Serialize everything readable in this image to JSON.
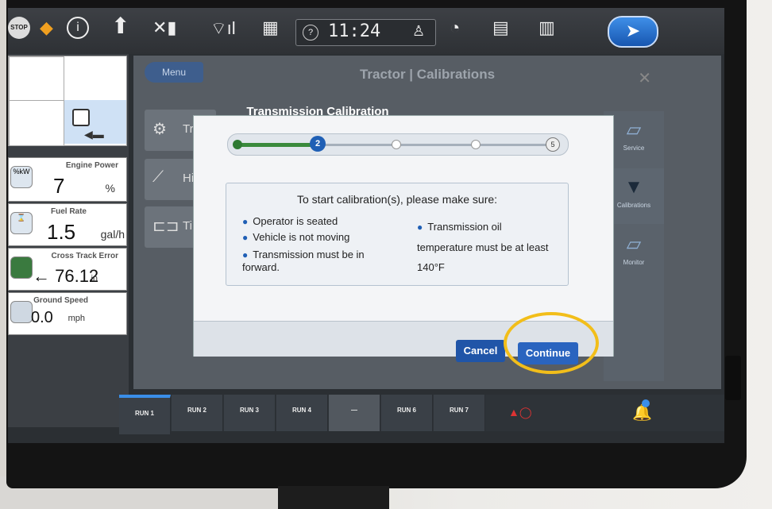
{
  "status_bar": {
    "stop_icon": "STOP",
    "time": "11:24",
    "home_icon": "home-arrow-icon"
  },
  "left_panel": {
    "gauges": [
      {
        "label": "Engine Power",
        "value": "7",
        "unit": "%",
        "icon": "%kW"
      },
      {
        "label": "Fuel Rate",
        "value": "1.5",
        "unit": "gal/h",
        "icon": "⌛"
      },
      {
        "label": "Cross Track Error",
        "value": "← 76.12",
        "unit": "in",
        "icon": ""
      },
      {
        "label": "Ground Speed",
        "value": "0.0",
        "unit": "mph",
        "icon": ""
      }
    ]
  },
  "main": {
    "menu_label": "Menu",
    "page_title": "Tractor | Calibrations",
    "rows": [
      {
        "label": "Tra",
        "icon": "gear-icon"
      },
      {
        "label": "Hit",
        "icon": "hitch-icon"
      },
      {
        "label": "Tir",
        "icon": "tire-icon"
      }
    ],
    "right_nav": [
      {
        "label": "Service"
      },
      {
        "label": "Calibrations"
      },
      {
        "label": "Monitor"
      }
    ]
  },
  "dialog": {
    "title": "Transmission Calibration",
    "current_step": "2",
    "last_step": "5",
    "instructions_title": "To start calibration(s), please make sure:",
    "left_items": [
      "Operator is seated",
      "Vehicle is not moving",
      "Transmission must be in forward."
    ],
    "right_items": [
      "Transmission oil temperature must be at least 140°F"
    ],
    "cancel_label": "Cancel",
    "continue_label": "Continue"
  },
  "run_bar": {
    "tabs": [
      "RUN 1",
      "RUN 2",
      "RUN 3",
      "RUN 4",
      "—",
      "RUN 6",
      "RUN 7"
    ]
  },
  "colors": {
    "accent_blue": "#2a64bf",
    "progress_green": "#3a8a3c",
    "highlight_yellow": "#f2be1a"
  }
}
